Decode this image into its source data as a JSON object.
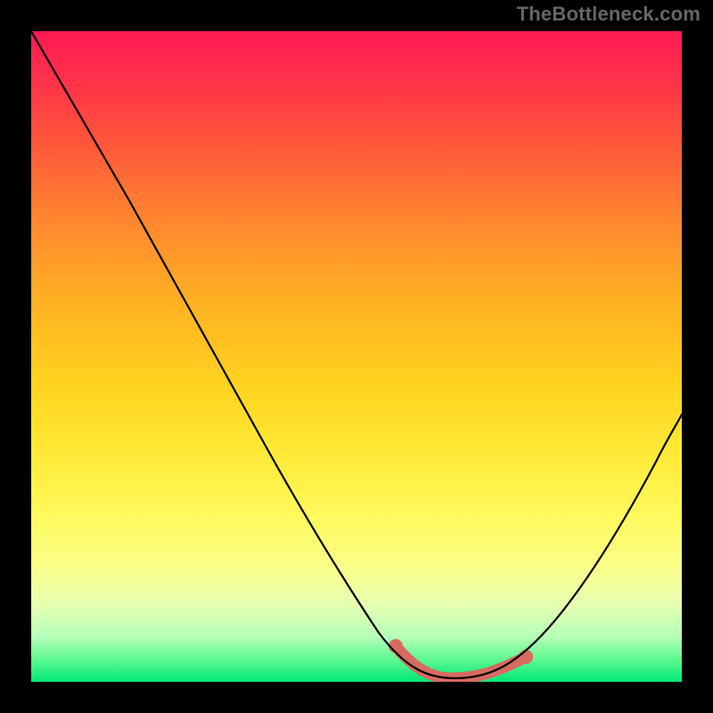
{
  "watermark": "TheBottleneck.com",
  "chart_data": {
    "type": "line",
    "title": "",
    "xlabel": "",
    "ylabel": "",
    "xlim": [
      0,
      100
    ],
    "ylim": [
      0,
      100
    ],
    "grid": false,
    "legend": false,
    "background_gradient": {
      "top_color": "#ff1a54",
      "bottom_color": "#00e877",
      "description": "red-to-yellow-to-green vertical gradient"
    },
    "series": [
      {
        "name": "bottleneck-curve",
        "color": "#000000",
        "x": [
          0,
          5,
          10,
          15,
          20,
          25,
          30,
          35,
          40,
          45,
          50,
          55,
          58,
          62,
          66,
          70,
          74,
          78,
          82,
          86,
          90,
          94,
          98,
          100
        ],
        "y": [
          100,
          93,
          85,
          77,
          69,
          60,
          51,
          42,
          33,
          24,
          15,
          8,
          4,
          1,
          0,
          0,
          1,
          3,
          7,
          12,
          19,
          27,
          36,
          41
        ]
      },
      {
        "name": "optimal-range-highlight",
        "color": "#d86a60",
        "x": [
          56,
          60,
          64,
          68,
          72,
          76
        ],
        "y": [
          6,
          2,
          0.5,
          0.5,
          1.5,
          4
        ]
      }
    ],
    "markers": [
      {
        "name": "optimal-start-dot",
        "x": 56,
        "y": 6,
        "color": "#d86a60"
      },
      {
        "name": "optimal-end-dot",
        "x": 76,
        "y": 4,
        "color": "#d86a60"
      }
    ]
  }
}
